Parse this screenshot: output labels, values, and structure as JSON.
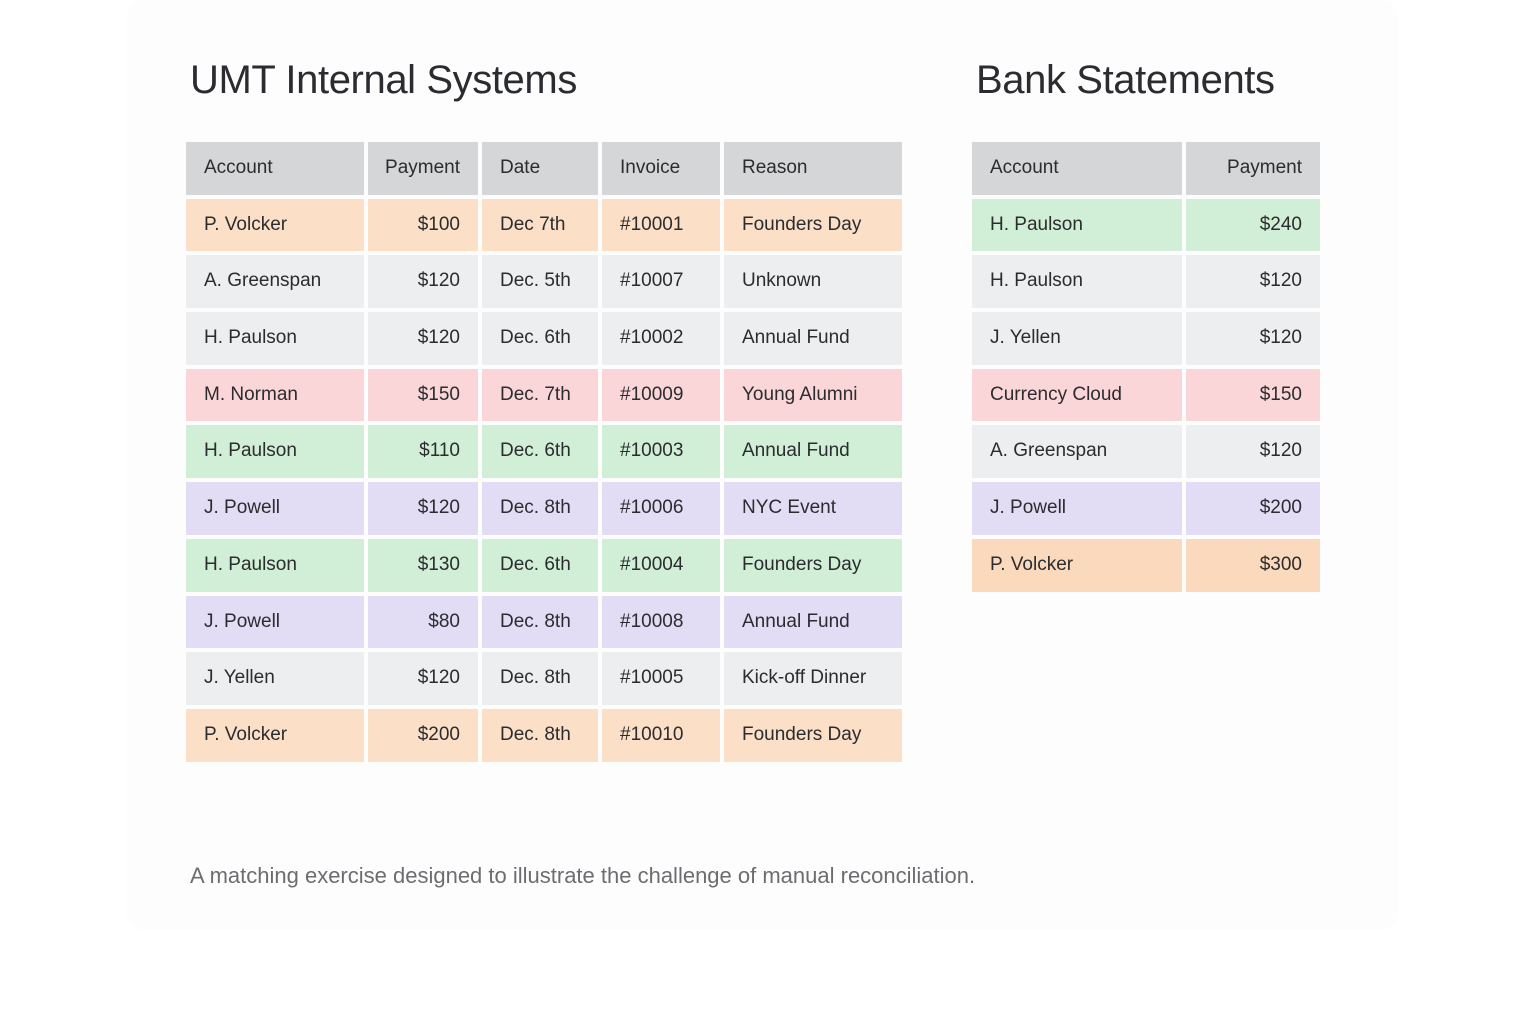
{
  "caption": "A matching exercise designed to illustrate the challenge of manual reconciliation.",
  "left": {
    "title": "UMT Internal Systems",
    "header": {
      "account": "Account",
      "payment": "Payment",
      "date": "Date",
      "invoice": "Invoice",
      "reason": "Reason"
    },
    "rows": [
      {
        "account": "P. Volcker",
        "payment": "$100",
        "date": "Dec 7th",
        "invoice": "#10001",
        "reason": "Founders Day",
        "color": "peach2"
      },
      {
        "account": "A. Greenspan",
        "payment": "$120",
        "date": "Dec. 5th",
        "invoice": "#10007",
        "reason": "Unknown",
        "color": "grey"
      },
      {
        "account": "H. Paulson",
        "payment": "$120",
        "date": "Dec. 6th",
        "invoice": "#10002",
        "reason": "Annual Fund",
        "color": "grey"
      },
      {
        "account": "M. Norman",
        "payment": "$150",
        "date": "Dec. 7th",
        "invoice": "#10009",
        "reason": "Young Alumni",
        "color": "pink"
      },
      {
        "account": "H. Paulson",
        "payment": "$110",
        "date": "Dec. 6th",
        "invoice": "#10003",
        "reason": "Annual Fund",
        "color": "green"
      },
      {
        "account": "J. Powell",
        "payment": "$120",
        "date": "Dec. 8th",
        "invoice": "#10006",
        "reason": "NYC Event",
        "color": "lilac"
      },
      {
        "account": "H. Paulson",
        "payment": "$130",
        "date": "Dec. 6th",
        "invoice": "#10004",
        "reason": "Founders Day",
        "color": "green"
      },
      {
        "account": "J. Powell",
        "payment": "$80",
        "date": "Dec. 8th",
        "invoice": "#10008",
        "reason": "Annual Fund",
        "color": "lilac"
      },
      {
        "account": "J. Yellen",
        "payment": "$120",
        "date": "Dec. 8th",
        "invoice": "#10005",
        "reason": "Kick-off Dinner",
        "color": "grey"
      },
      {
        "account": "P. Volcker",
        "payment": "$200",
        "date": "Dec. 8th",
        "invoice": "#10010",
        "reason": "Founders Day",
        "color": "peach2"
      }
    ]
  },
  "right": {
    "title": "Bank Statements",
    "header": {
      "account": "Account",
      "payment": "Payment"
    },
    "rows": [
      {
        "account": "H. Paulson",
        "payment": "$240",
        "color": "green"
      },
      {
        "account": "H. Paulson",
        "payment": "$120",
        "color": "grey"
      },
      {
        "account": "J. Yellen",
        "payment": "$120",
        "color": "grey"
      },
      {
        "account": "Currency Cloud",
        "payment": "$150",
        "color": "pink"
      },
      {
        "account": "A. Greenspan",
        "payment": "$120",
        "color": "grey"
      },
      {
        "account": "J. Powell",
        "payment": "$200",
        "color": "lilac"
      },
      {
        "account": "P. Volcker",
        "payment": "$300",
        "color": "peach"
      }
    ]
  }
}
